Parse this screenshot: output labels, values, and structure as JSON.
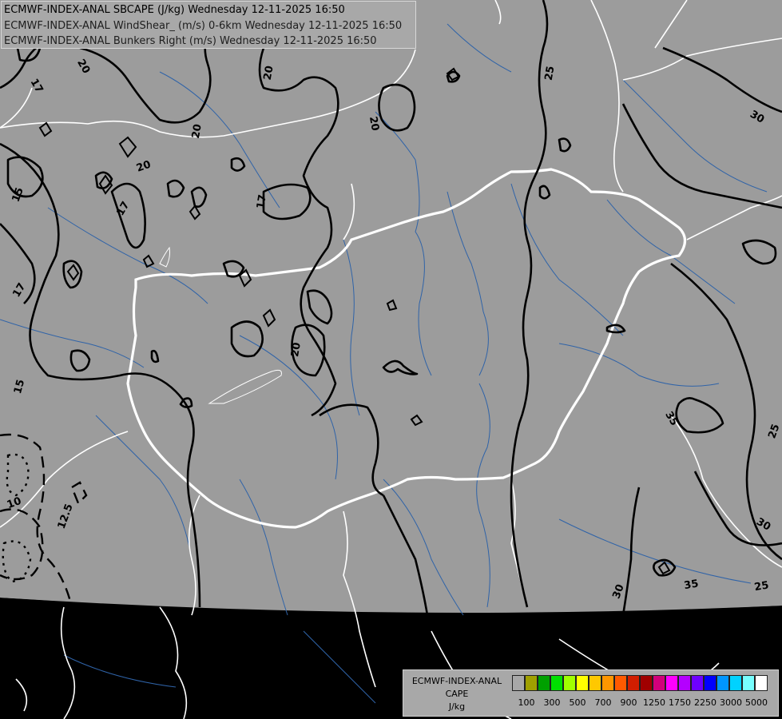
{
  "header": {
    "line1": "ECMWF-INDEX-ANAL SBCAPE (J/kg) Wednesday 12-11-2025 16:50",
    "line2": "ECMWF-INDEX-ANAL WindShear_ (m/s) 0-6km Wednesday 12-11-2025 16:50",
    "line3": "ECMWF-INDEX-ANAL Bunkers Right (m/s) Wednesday 12-11-2025 16:50"
  },
  "legend": {
    "line1": "ECMWF-INDEX-ANAL",
    "line2": "CAPE",
    "line3": "J/kg",
    "colors": [
      "#a8a8a8",
      "#a0a000",
      "#00a000",
      "#00e000",
      "#a0ff00",
      "#ffff00",
      "#ffc800",
      "#ff9600",
      "#ff5a00",
      "#d21e00",
      "#a00000",
      "#d2007a",
      "#ff00ff",
      "#b400ff",
      "#6e00ff",
      "#0000ff",
      "#0096ff",
      "#00d2ff",
      "#78ffff",
      "#ffffff"
    ],
    "labels": [
      "100",
      "300",
      "500",
      "700",
      "900",
      "1250",
      "1750",
      "2250",
      "3000",
      "5000"
    ]
  },
  "contour_labels": [
    {
      "t": "17"
    },
    {
      "t": "20"
    },
    {
      "t": "20"
    },
    {
      "t": "20"
    },
    {
      "t": "20"
    },
    {
      "t": "17"
    },
    {
      "t": "15"
    },
    {
      "t": "17"
    },
    {
      "t": "17"
    },
    {
      "t": "20"
    },
    {
      "t": "20"
    },
    {
      "t": "15"
    },
    {
      "t": "10"
    },
    {
      "t": "12.5"
    },
    {
      "t": "25"
    },
    {
      "t": "30"
    },
    {
      "t": "35"
    },
    {
      "t": "25"
    },
    {
      "t": "30"
    },
    {
      "t": "35"
    },
    {
      "t": "25"
    },
    {
      "t": "30"
    }
  ]
}
